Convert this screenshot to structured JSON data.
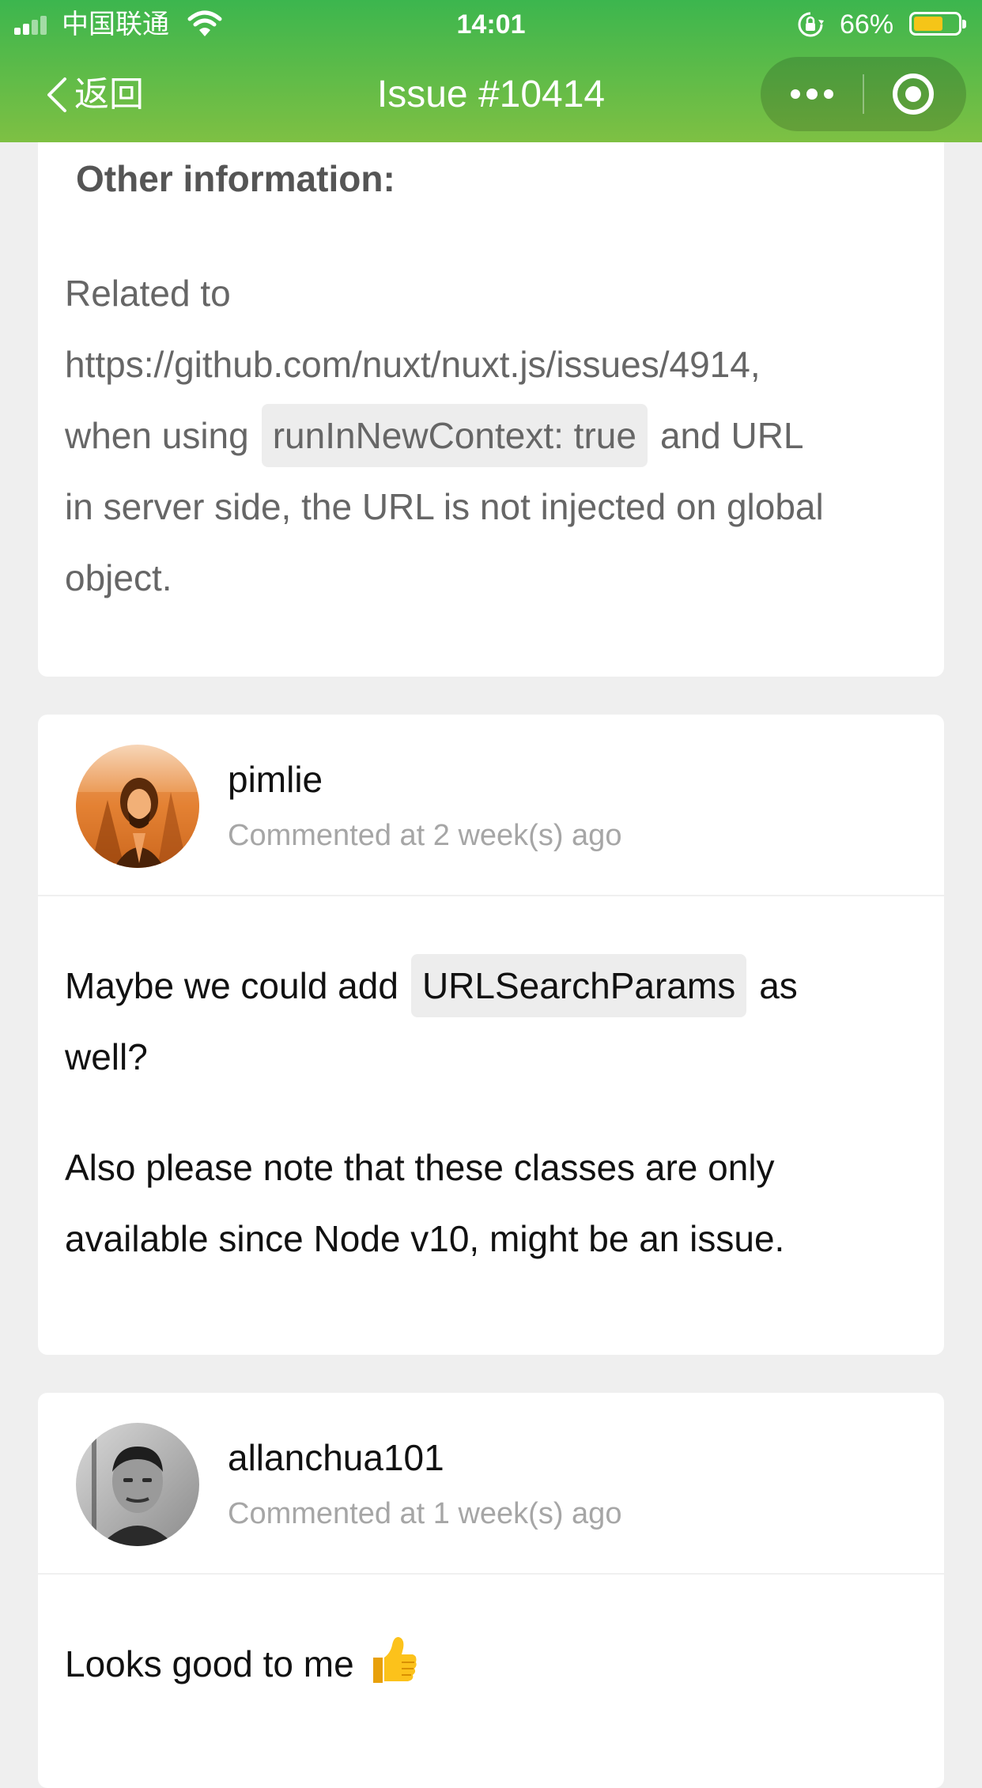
{
  "status_bar": {
    "carrier": "中国联通",
    "time": "14:01",
    "battery_percent": "66%",
    "battery_level": 0.66
  },
  "nav": {
    "back_label": "返回",
    "title": "Issue #10414"
  },
  "issue_body": {
    "heading": "Other information:",
    "line1": "Related to",
    "line2": "https://github.com/nuxt/nuxt.js/issues/4914,",
    "line3_prefix": "when using",
    "line3_code": "runInNewContext: true",
    "line3_suffix": "and URL",
    "line4": "in server side, the URL is not injected on global",
    "line5": "object."
  },
  "comments": [
    {
      "user": "pimlie",
      "time": "Commented at 2 week(s) ago",
      "p1_prefix": "Maybe we could add",
      "p1_code": "URLSearchParams",
      "p1_suffix": "as",
      "p1_line2": "well?",
      "p2_line1": "Also please note that these classes are only",
      "p2_line2": "available since Node v10, might be an issue."
    },
    {
      "user": "allanchua101",
      "time": "Commented at 1 week(s) ago",
      "text": "Looks good to me",
      "emoji_icon": "thumbs-up-icon"
    }
  ]
}
